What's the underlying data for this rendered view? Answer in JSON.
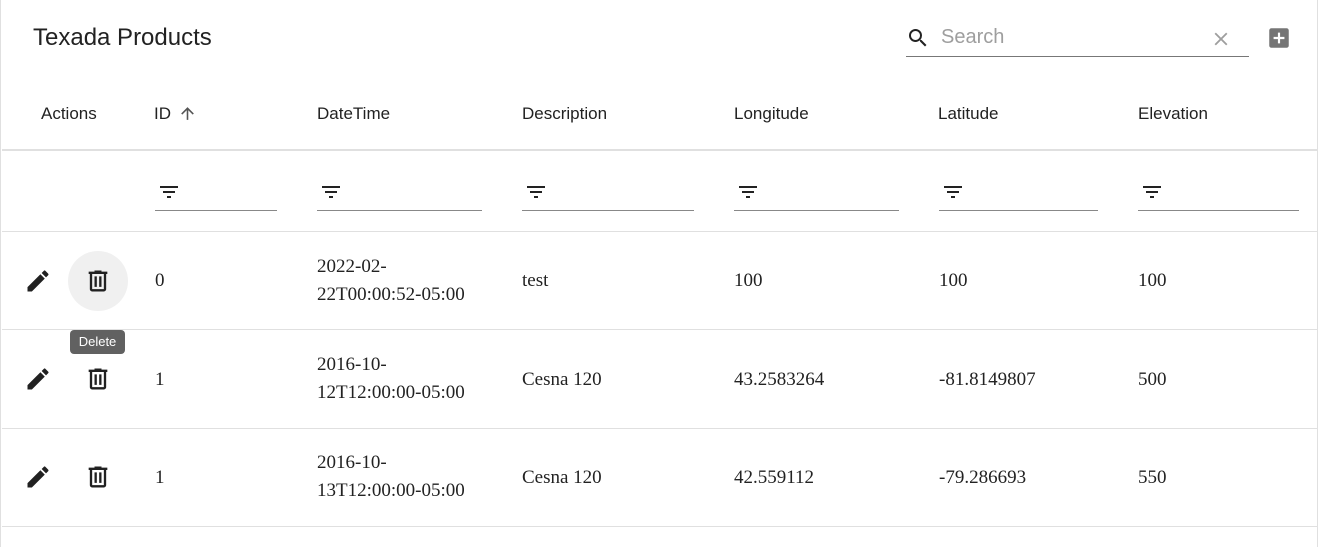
{
  "title": "Texada Products",
  "search": {
    "placeholder": "Search",
    "value": ""
  },
  "columns": [
    "Actions",
    "ID",
    "DateTime",
    "Description",
    "Longitude",
    "Latitude",
    "Elevation"
  ],
  "sort": {
    "column": "ID",
    "direction": "ascending"
  },
  "tooltip": "Delete",
  "rows": [
    {
      "id": "0",
      "datetime_line1": "2022-02-",
      "datetime_line2": "22T00:00:52-05:00",
      "description": "test",
      "longitude": "100",
      "latitude": "100",
      "elevation": "100"
    },
    {
      "id": "1",
      "datetime_line1": "2016-10-",
      "datetime_line2": "12T12:00:00-05:00",
      "description": "Cesna 120",
      "longitude": "43.2583264",
      "latitude": "-81.8149807",
      "elevation": "500"
    },
    {
      "id": "1",
      "datetime_line1": "2016-10-",
      "datetime_line2": "13T12:00:00-05:00",
      "description": "Cesna 120",
      "longitude": "42.559112",
      "latitude": "-79.286693",
      "elevation": "550"
    }
  ],
  "icons": {
    "search": "search-icon",
    "clear": "close-icon",
    "add": "add-box-icon",
    "sort": "arrow-up-icon",
    "filter": "filter-icon",
    "edit": "pencil-icon",
    "delete": "trash-icon"
  }
}
